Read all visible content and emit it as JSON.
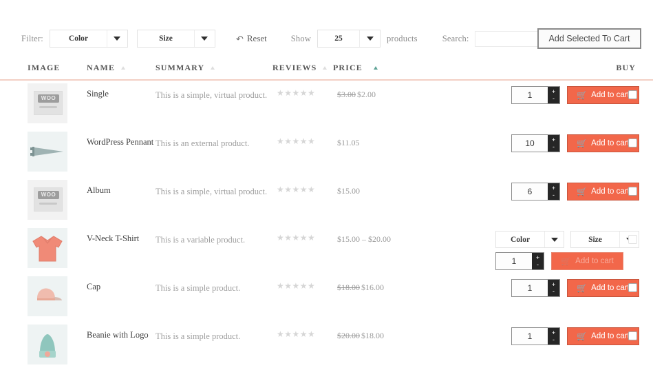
{
  "toolbar": {
    "filter_label": "Filter:",
    "filters": [
      {
        "name": "color",
        "value": "Color"
      },
      {
        "name": "size",
        "value": "Size"
      }
    ],
    "reset_label": "Reset",
    "reset_icon": "reset-arrow-icon",
    "show_label": "Show",
    "show_value": "25",
    "products_label": "products",
    "search_label": "Search:",
    "search_value": "",
    "search_placeholder": "",
    "add_selected_label": "Add Selected To Cart"
  },
  "table": {
    "columns": [
      {
        "key": "image",
        "label": "IMAGE",
        "sortable": false,
        "sort": "none"
      },
      {
        "key": "name",
        "label": "NAME",
        "sortable": true,
        "sort": "none"
      },
      {
        "key": "summary",
        "label": "SUMMARY",
        "sortable": true,
        "sort": "none"
      },
      {
        "key": "reviews",
        "label": "REVIEWS",
        "sortable": true,
        "sort": "none"
      },
      {
        "key": "price",
        "label": "PRICE",
        "sortable": true,
        "sort": "asc"
      },
      {
        "key": "buy",
        "label": "BUY",
        "sortable": false,
        "sort": "none"
      }
    ],
    "sort_active_color": "#5fa396",
    "header_rule_color": "#f3cfc4",
    "rows": [
      {
        "image": "woo-placeholder",
        "name": "Single",
        "summary": "This is a simple, virtual product.",
        "stars": "★★★★★",
        "rating": 0,
        "price_old": "$3.00",
        "price": "$2.00",
        "qty": "1",
        "add_label": "Add to cart",
        "add_disabled": false,
        "variations": [],
        "checked": false,
        "checkbox_disabled": false
      },
      {
        "image": "pennant",
        "name": "WordPress Pennant",
        "summary": "This is an external product.",
        "stars": "★★★★★",
        "rating": 0,
        "price_old": "",
        "price": "$11.05",
        "qty": "10",
        "add_label": "Add to cart",
        "add_disabled": false,
        "variations": [],
        "checked": false,
        "checkbox_disabled": false
      },
      {
        "image": "woo-placeholder",
        "name": "Album",
        "summary": "This is a simple, virtual product.",
        "stars": "★★★★★",
        "rating": 0,
        "price_old": "",
        "price": "$15.00",
        "qty": "6",
        "add_label": "Add to cart",
        "add_disabled": false,
        "variations": [],
        "checked": false,
        "checkbox_disabled": false
      },
      {
        "image": "tshirt",
        "name": "V-Neck T-Shirt",
        "summary": "This is a variable product.",
        "stars": "★★★★★",
        "rating": 0,
        "price_old": "",
        "price": "$15.00 – $20.00",
        "qty": "1",
        "add_label": "Add to cart",
        "add_disabled": true,
        "variations": [
          {
            "name": "color",
            "value": "Color"
          },
          {
            "name": "size",
            "value": "Size"
          }
        ],
        "checked": false,
        "checkbox_disabled": true
      },
      {
        "image": "cap",
        "name": "Cap",
        "summary": "This is a simple product.",
        "stars": "★★★★★",
        "rating": 0,
        "price_old": "$18.00",
        "price": "$16.00",
        "qty": "1",
        "add_label": "Add to cart",
        "add_disabled": false,
        "variations": [],
        "checked": false,
        "checkbox_disabled": false
      },
      {
        "image": "beanie",
        "name": "Beanie with Logo",
        "summary": "This is a simple product.",
        "stars": "★★★★★",
        "rating": 0,
        "price_old": "$20.00",
        "price": "$18.00",
        "qty": "1",
        "add_label": "Add to cart",
        "add_disabled": false,
        "variations": [],
        "checked": false,
        "checkbox_disabled": false
      }
    ]
  },
  "colors": {
    "accent": "#f2674a",
    "sort_active": "#5fa396",
    "rule": "#f3cfc4",
    "star": "#d6d6d6"
  },
  "icons": {
    "cart": "🛒",
    "caret_down": "caret-down-icon",
    "step_up": "+",
    "step_down": "-"
  }
}
